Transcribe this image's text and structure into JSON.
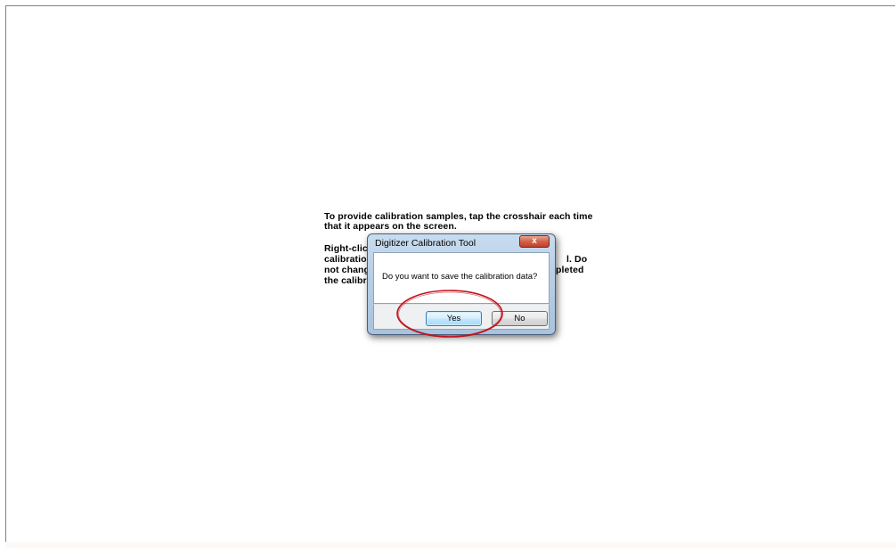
{
  "instructions": {
    "line1": "To provide calibration samples, tap the crosshair each time",
    "line2": "that it appears on the screen.",
    "p2_line1": "Right-click",
    "p2_line2": "calibration",
    "p2_line3": "not change",
    "p2_line4": "the calibra",
    "p2_right1": "l. Do",
    "p2_right2": "pleted"
  },
  "dialog": {
    "title": "Digitizer Calibration Tool",
    "close_glyph": "x",
    "message": "Do you want to save the calibration data?",
    "yes_label": "Yes",
    "no_label": "No"
  },
  "colors": {
    "highlight": "#c0121a",
    "default_button_border": "#3c7fb1",
    "close_button": "#c0402c"
  }
}
